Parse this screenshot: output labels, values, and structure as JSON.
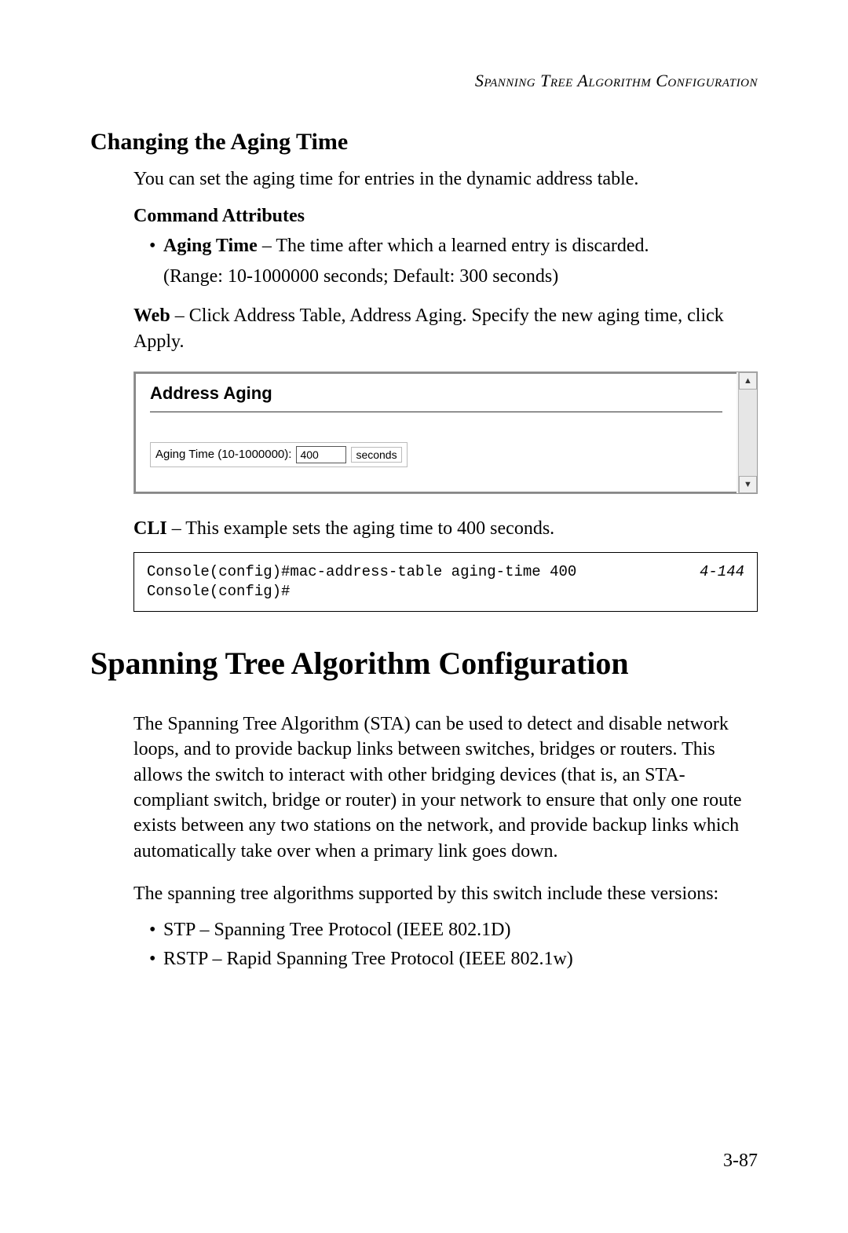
{
  "running_header": "Spanning Tree Algorithm Configuration",
  "section": {
    "title": "Changing the Aging Time",
    "intro": "You can set the aging time for entries in the dynamic address table.",
    "command_attributes_label": "Command Attributes",
    "attr_bullet_bold": "Aging Time",
    "attr_bullet_rest": " – The time after which a learned entry is discarded.",
    "attr_bullet_sub": "(Range: 10-1000000 seconds; Default: 300 seconds)",
    "web_label": "Web",
    "web_text": " – Click Address Table, Address Aging. Specify the new aging time, click Apply."
  },
  "ui": {
    "panel_title": "Address Aging",
    "field_label": "Aging Time (10-1000000):",
    "field_value": "400",
    "field_unit": "seconds"
  },
  "cli": {
    "label": "CLI",
    "text": " – This example sets the aging time to 400 seconds.",
    "line1": "Console(config)#mac-address-table aging-time 400",
    "line2": "Console(config)#",
    "ref": "4-144"
  },
  "chapter": {
    "title": "Spanning Tree Algorithm Configuration",
    "para1": "The Spanning Tree Algorithm (STA) can be used to detect and disable network loops, and to provide backup links between switches, bridges or routers. This allows the switch to interact with other bridging devices (that is, an STA-compliant switch, bridge or router) in your network to ensure that only one route exists between any two stations on the network, and provide backup links which automatically take over when a primary link goes down.",
    "para2": "The spanning tree algorithms supported by this switch include these versions:",
    "bullets": [
      "STP – Spanning Tree Protocol (IEEE 802.1D)",
      "RSTP – Rapid Spanning Tree Protocol (IEEE 802.1w)"
    ]
  },
  "page_number": "3-87"
}
